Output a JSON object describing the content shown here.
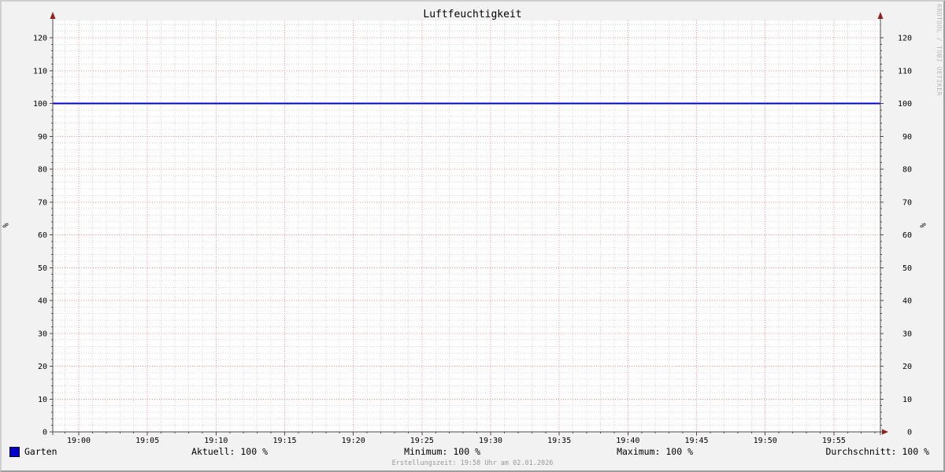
{
  "watermark": "RRDTOOL / TOBI OETIKER",
  "chart_data": {
    "type": "line",
    "title": "Luftfeuchtigkeit",
    "ylabel": "%",
    "ylabel_right": "%",
    "ylim": [
      0,
      125
    ],
    "y_label_max": 120,
    "y_major_step": 10,
    "y_minor_step": 2,
    "x_ticks": [
      "19:00",
      "19:05",
      "19:10",
      "19:15",
      "19:20",
      "19:25",
      "19:30",
      "19:35",
      "19:40",
      "19:45",
      "19:50",
      "19:55"
    ],
    "x_minor_per_major": 5,
    "x_range": [
      "18:58",
      "19:58"
    ],
    "grid": true,
    "legend_position": "bottom",
    "series": [
      {
        "name": "Garten",
        "color": "#0000cc",
        "y_constant": 100,
        "values": [
          100,
          100,
          100,
          100,
          100,
          100,
          100,
          100,
          100,
          100,
          100,
          100
        ]
      }
    ],
    "stats": {
      "aktuell": "100 %",
      "minimum": "100 %",
      "maximum": "100 %",
      "durchschnitt": "100 %"
    }
  },
  "legend": {
    "series_label": "Garten",
    "swatch_color": "#0000cc",
    "stats": [
      {
        "label": "Aktuell: 100 %"
      },
      {
        "label": "Minimum: 100 %"
      },
      {
        "label": "Maximum: 100 %"
      },
      {
        "label": "Durchschnitt: 100 %"
      }
    ]
  },
  "footer": {
    "creation_text": "Erstellungszeit: 19:58 Uhr am 02.01.2026"
  },
  "colors": {
    "background": "#f2f2f2",
    "plot_background": "#ffffff",
    "grid_minor": "#d4d4d4",
    "grid_major": "#f29191",
    "axis": "#4d4d4d",
    "arrow": "#8e2222",
    "line": "#0000cc",
    "bevel_light": "#cfcfcf",
    "bevel_dark": "#9e9e9e",
    "watermark_text": "#b9b9b9",
    "footer_text": "#999999"
  }
}
